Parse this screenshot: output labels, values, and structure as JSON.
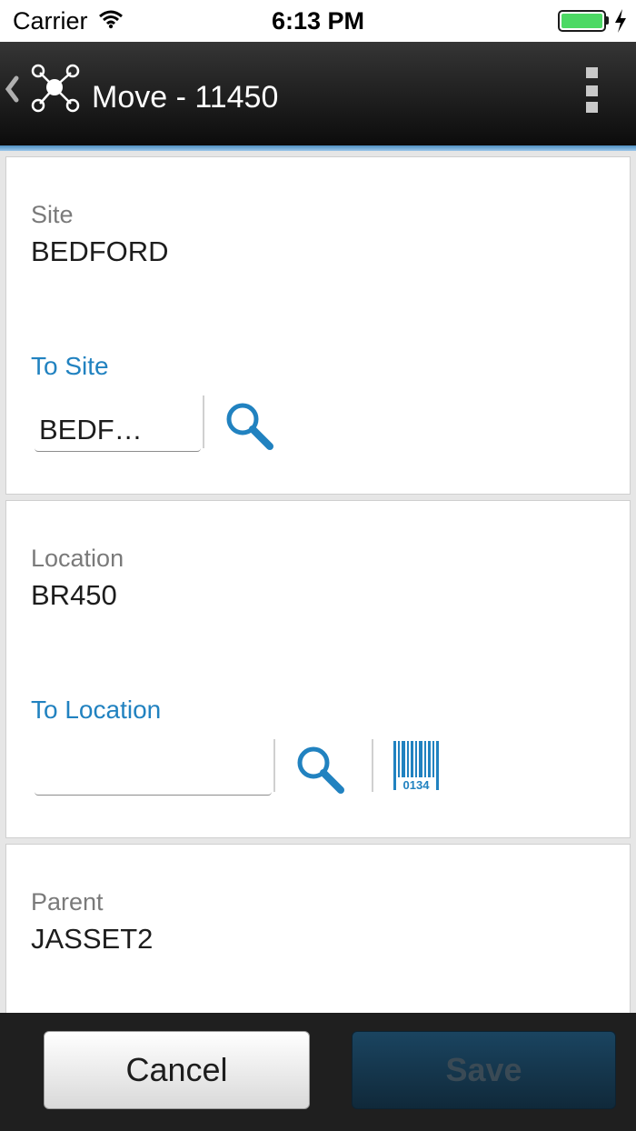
{
  "status_bar": {
    "carrier": "Carrier",
    "time": "6:13 PM"
  },
  "header": {
    "title": "Move - 11450",
    "back_icon": "chevron-left-icon",
    "app_icon": "network-nodes-icon",
    "menu_icon": "vertical-ellipsis-icon"
  },
  "site_card": {
    "site_label": "Site",
    "site_value": "BEDFORD",
    "to_site_label": "To Site",
    "to_site_value": "BEDF…"
  },
  "location_card": {
    "location_label": "Location",
    "location_value": "BR450",
    "to_location_label": "To Location",
    "to_location_value": "",
    "barcode_digits": "0134"
  },
  "parent_card": {
    "parent_label": "Parent",
    "parent_value": "JASSET2"
  },
  "footer": {
    "cancel_label": "Cancel",
    "save_label": "Save"
  },
  "colors": {
    "accent": "#2182c0",
    "header_bg": "#1a1a1a",
    "header_underline": "#6aa8d8",
    "save_bg": "#163a52",
    "battery": "#4cd964"
  }
}
